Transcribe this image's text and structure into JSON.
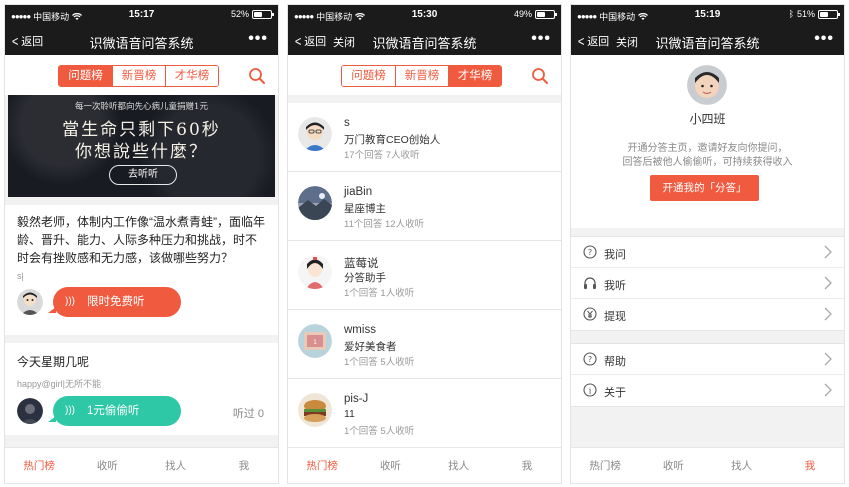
{
  "colors": {
    "accent": "#f05a3f",
    "green": "#2ec8a6",
    "dark": "#1b1b1b"
  },
  "screens": [
    {
      "status": {
        "carrier": "中国移动",
        "time": "15:17",
        "battery": "52%",
        "battery_level": 0.52
      },
      "nav": {
        "back": "返回",
        "close": "",
        "title": "识微语音问答系统",
        "more": "•••"
      },
      "tabs": [
        "问题榜",
        "新晋榜",
        "才华榜"
      ],
      "active_tab": 0,
      "banner": {
        "top": "每一次聆听都向先心病儿童捐赠1元",
        "line1": "當生命只剩下60秒",
        "line2": "你想說些什麼？",
        "button": "去听听"
      },
      "questions": [
        {
          "text": "毅然老师，体制内工作像“温水煮青蛙”，面临年龄、晋升、能力、人际多种压力和挑战，时不时会有挫败感和无力感，该做哪些努力？",
          "meta": "s|",
          "button": "限时免费听",
          "listen": ""
        },
        {
          "text": "今天星期几呢",
          "meta": "happy@girl|无所不能",
          "button": "1元偷偷听",
          "listen": "听过 0"
        }
      ],
      "bottom_tabs": [
        "热门榜",
        "收听",
        "找人",
        "我"
      ],
      "active_bottom": 0
    },
    {
      "status": {
        "carrier": "中国移动",
        "time": "15:30",
        "battery": "49%",
        "battery_level": 0.49
      },
      "nav": {
        "back": "返回",
        "close": "关闭",
        "title": "识微语音问答系统",
        "more": "•••"
      },
      "tabs": [
        "问题榜",
        "新晋榜",
        "才华榜"
      ],
      "active_tab": 2,
      "users": [
        {
          "name": "s",
          "title": "万门教育CEO创始人",
          "stats": "17个回答 7人收听"
        },
        {
          "name": "jiaBin",
          "title": "星座博主",
          "stats": "11个回答 12人收听"
        },
        {
          "name": "蓝莓说",
          "title": "分答助手",
          "stats": "1个回答 1人收听"
        },
        {
          "name": "wmiss",
          "title": "爱好美食者",
          "stats": "1个回答 5人收听"
        },
        {
          "name": "pis-J",
          "title": "11",
          "stats": "1个回答 5人收听"
        }
      ],
      "bottom_tabs": [
        "热门榜",
        "收听",
        "找人",
        "我"
      ],
      "active_bottom": 0
    },
    {
      "status": {
        "carrier": "中国移动",
        "time": "15:19",
        "battery": "51%",
        "battery_level": 0.51
      },
      "nav": {
        "back": "返回",
        "close": "关闭",
        "title": "识微语音问答系统",
        "more": "•••"
      },
      "profile": {
        "name": "小四班",
        "desc1": "开通分答主页，邀请好友向你提问，",
        "desc2": "回答后被他人偷偷听，可持续获得收入",
        "button": "开通我的「分答」"
      },
      "menu1": [
        {
          "label": "我问",
          "icon": "question-icon"
        },
        {
          "label": "我听",
          "icon": "headphones-icon"
        },
        {
          "label": "提现",
          "icon": "withdraw-icon"
        }
      ],
      "menu2": [
        {
          "label": "帮助",
          "icon": "help-icon"
        },
        {
          "label": "关于",
          "icon": "info-icon"
        }
      ],
      "bottom_tabs": [
        "热门榜",
        "收听",
        "找人",
        "我"
      ],
      "active_bottom": 3
    }
  ]
}
